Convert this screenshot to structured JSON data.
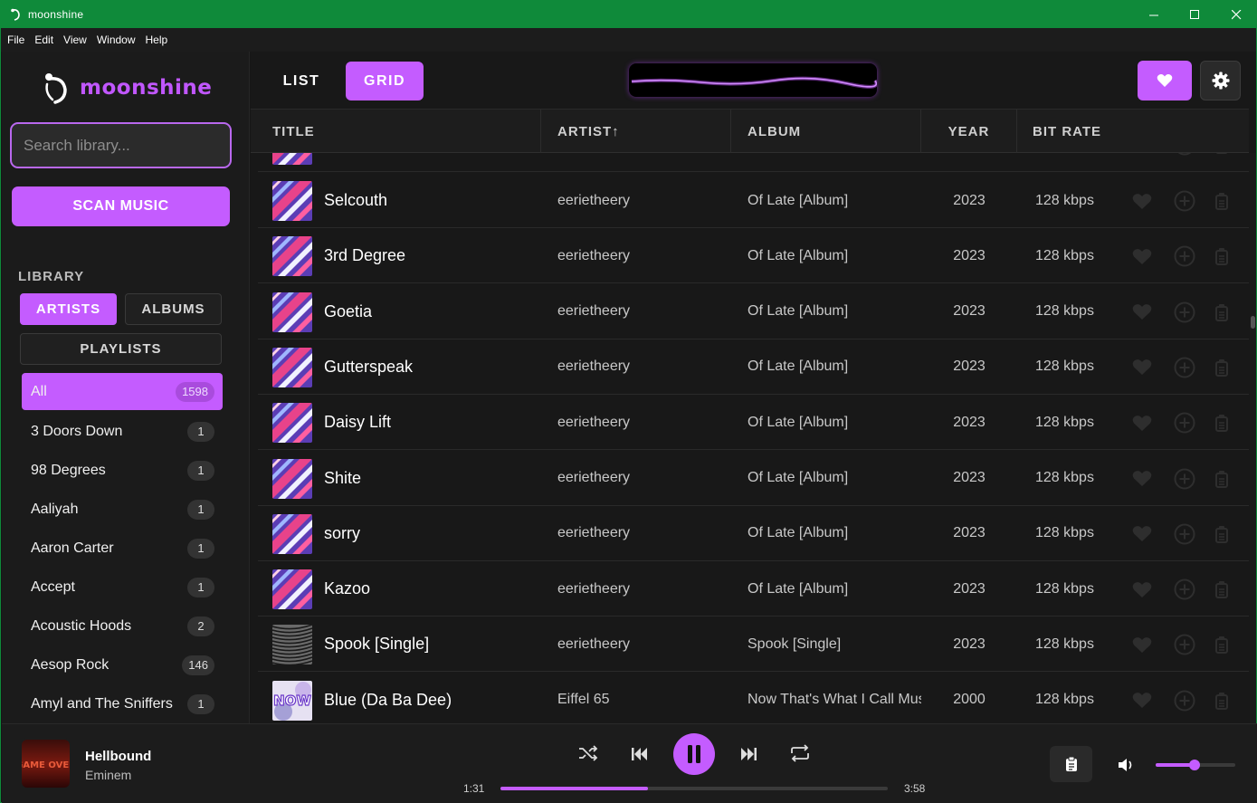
{
  "titlebar": {
    "title": "moonshine"
  },
  "menu": [
    "File",
    "Edit",
    "View",
    "Window",
    "Help"
  ],
  "sidebar": {
    "logo": "moonshine",
    "search_placeholder": "Search library...",
    "scan_label": "SCAN MUSIC",
    "library_label": "LIBRARY",
    "tabs": {
      "artists": "ARTISTS",
      "albums": "ALBUMS",
      "playlists": "PLAYLISTS"
    },
    "artists": [
      {
        "name": "All",
        "count": "1598",
        "active": true
      },
      {
        "name": "3 Doors Down",
        "count": "1"
      },
      {
        "name": "98 Degrees",
        "count": "1"
      },
      {
        "name": "Aaliyah",
        "count": "1"
      },
      {
        "name": "Aaron Carter",
        "count": "1"
      },
      {
        "name": "Accept",
        "count": "1"
      },
      {
        "name": "Acoustic Hoods",
        "count": "2"
      },
      {
        "name": "Aesop Rock",
        "count": "146"
      },
      {
        "name": "Amyl and The Sniffers",
        "count": "1"
      }
    ]
  },
  "toolbar": {
    "list_label": "LIST",
    "grid_label": "GRID"
  },
  "table": {
    "headers": {
      "title": "TITLE",
      "artist": "ARTIST↑",
      "album": "ALBUM",
      "year": "YEAR",
      "bitrate": "BIT RATE"
    },
    "rows": [
      {
        "title": "Selcouth",
        "artist": "eerietheery",
        "album": "Of Late [Album]",
        "year": "2023",
        "bitrate": "128 kbps",
        "art": "oflate"
      },
      {
        "title": "3rd Degree",
        "artist": "eerietheery",
        "album": "Of Late [Album]",
        "year": "2023",
        "bitrate": "128 kbps",
        "art": "oflate"
      },
      {
        "title": "Goetia",
        "artist": "eerietheery",
        "album": "Of Late [Album]",
        "year": "2023",
        "bitrate": "128 kbps",
        "art": "oflate"
      },
      {
        "title": "Gutterspeak",
        "artist": "eerietheery",
        "album": "Of Late [Album]",
        "year": "2023",
        "bitrate": "128 kbps",
        "art": "oflate"
      },
      {
        "title": "Daisy Lift",
        "artist": "eerietheery",
        "album": "Of Late [Album]",
        "year": "2023",
        "bitrate": "128 kbps",
        "art": "oflate"
      },
      {
        "title": "Shite",
        "artist": "eerietheery",
        "album": "Of Late [Album]",
        "year": "2023",
        "bitrate": "128 kbps",
        "art": "oflate"
      },
      {
        "title": "sorry",
        "artist": "eerietheery",
        "album": "Of Late [Album]",
        "year": "2023",
        "bitrate": "128 kbps",
        "art": "oflate"
      },
      {
        "title": "Kazoo",
        "artist": "eerietheery",
        "album": "Of Late [Album]",
        "year": "2023",
        "bitrate": "128 kbps",
        "art": "oflate"
      },
      {
        "title": "Spook [Single]",
        "artist": "eerietheery",
        "album": "Spook [Single]",
        "year": "2023",
        "bitrate": "128 kbps",
        "art": "spook"
      },
      {
        "title": "Blue (Da Ba Dee)",
        "artist": "Eiffel 65",
        "album": "Now That's What I Call Mus",
        "year": "2000",
        "bitrate": "128 kbps",
        "art": "now"
      }
    ]
  },
  "player": {
    "title": "Hellbound",
    "artist": "Eminem",
    "cover_text": "GAME OVER",
    "elapsed": "1:31",
    "duration": "3:58",
    "progress": 0.38,
    "volume": 0.49
  },
  "colors": {
    "accent": "#c45cff",
    "titlebar": "#0f8a3a",
    "background": "#181818"
  }
}
